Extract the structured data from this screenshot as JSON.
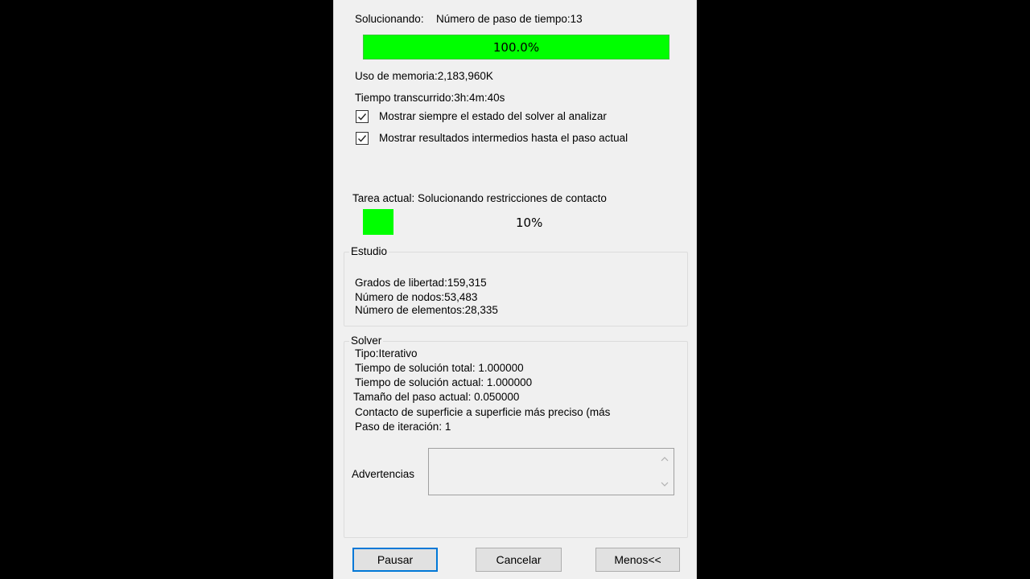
{
  "header": {
    "status_label": "Solucionando:",
    "timestep_label": "Número de paso de tiempo:13"
  },
  "progress": {
    "overall_percent": 100.0,
    "overall_text": "100.0%",
    "task_percent": 10,
    "task_text": "10%"
  },
  "info": {
    "memory": "Uso de memoria:2,183,960K",
    "elapsed": "Tiempo transcurrido:3h:4m:40s"
  },
  "options": [
    {
      "label": "Mostrar siempre el estado del solver al analizar",
      "checked": true
    },
    {
      "label": "Mostrar resultados intermedios hasta el paso actual",
      "checked": true
    }
  ],
  "task": {
    "current": "Tarea actual: Solucionando restricciones de contacto"
  },
  "study": {
    "title": "Estudio",
    "dof": "Grados de libertad:159,315",
    "nodes": "Número de nodos:53,483",
    "elements": "Número de elementos:28,335"
  },
  "solver": {
    "title": "Solver",
    "type": "Tipo:Iterativo",
    "total_time": "Tiempo de solución total:  1.000000",
    "current_time": "Tiempo de solución actual:  1.000000",
    "step_size": "Tamaño del paso actual: 0.050000",
    "contact": "Contacto de superficie a superficie más preciso (más",
    "iteration": "Paso de iteración: 1",
    "warnings_label": "Advertencias"
  },
  "buttons": {
    "pause": "Pausar",
    "cancel": "Cancelar",
    "less": "Menos<<"
  },
  "colors": {
    "progress_fill": "#00ff00",
    "default_button_border": "#0078d7",
    "dialog_bg": "#f0f0f0",
    "backdrop": "#000000"
  }
}
